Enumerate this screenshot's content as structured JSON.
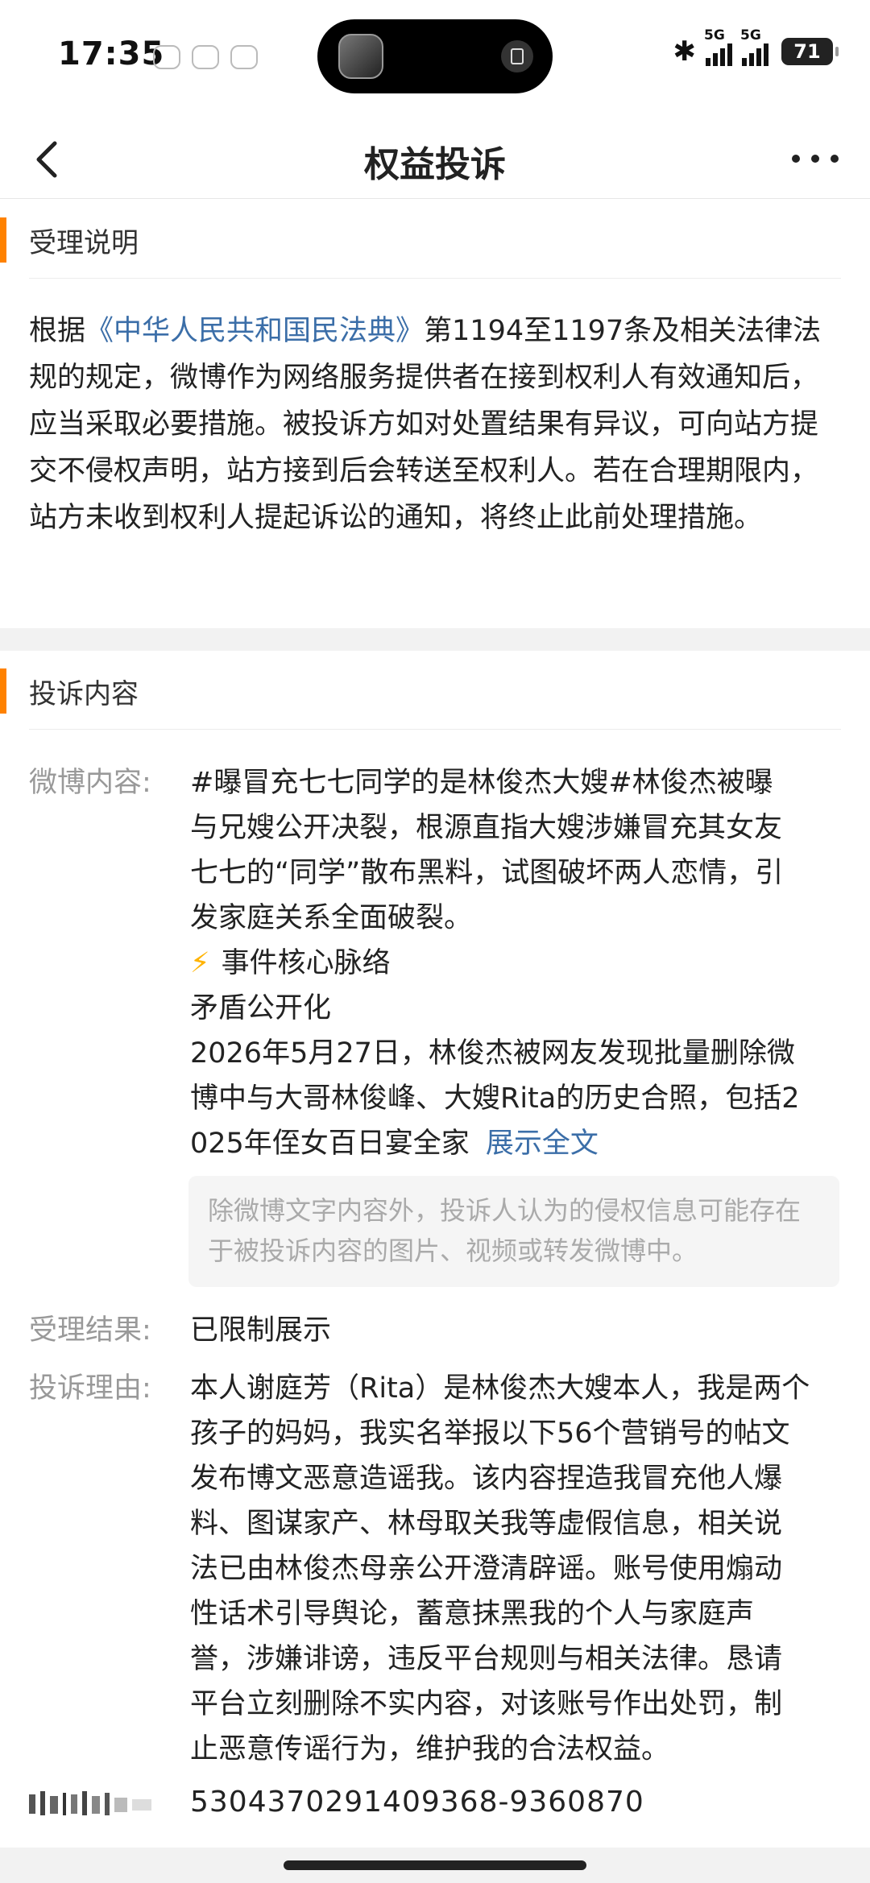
{
  "status_bar": {
    "time": "17:35",
    "network_label_1": "5G",
    "network_label_2": "5G",
    "battery": "71",
    "bluetooth_symbol": "✱"
  },
  "nav": {
    "title": "权益投诉"
  },
  "notice_section": {
    "title": "受理说明",
    "text_before_link": "根据",
    "law_link": "《中华人民共和国民法典》",
    "text_after_link": "第1194至1197条及相关法律法规的规定，微博作为网络服务提供者在接到权利人有效通知后，应当采取必要措施。被投诉方如对处置结果有异议，可向站方提交不侵权声明，站方接到后会转送至权利人。若在合理期限内，站方未收到权利人提起诉讼的通知，将终止此前处理措施。"
  },
  "complaint_section": {
    "title": "投诉内容",
    "weibo_content_label": "微博内容:",
    "weibo_content_lines": [
      "#曝冒充七七同学的是林俊杰大嫂#林俊杰被曝",
      "与兄嫂公开决裂，根源直指大嫂涉嫌冒充其女友",
      "七七的“同学”散布黑料，试图破坏两人恋情，引",
      "发家庭关系全面破裂。",
      "事件核心脉络",
      "矛盾公开化",
      "2026年5月27日，林俊杰被网友发现批量删除微",
      "博中与大哥林俊峰、大嫂Rita的历史合照，包括2",
      "025年侄女百日宴全家"
    ],
    "bolt_symbol": "⚡",
    "expand_link": "展示全文",
    "hint": "除微博文字内容外，投诉人认为的侵权信息可能存在于被投诉内容的图片、视频或转发微博中。",
    "result_label": "受理结果:",
    "result_value": "已限制展示",
    "reason_label": "投诉理由:",
    "reason_lines": [
      "本人谢庭芳（Rita）是林俊杰大嫂本人，我是两个",
      "孩子的妈妈，我实名举报以下56个营销号的帖文",
      "发布博文恶意造谣我。该内容捏造我冒充他人爆",
      "料、图谋家产、林母取关我等虚假信息，相关说",
      "法已由林俊杰母亲公开澄清辟谣。账号使用煽动",
      "性话术引导舆论，蓄意抹黑我的个人与家庭声",
      "誉，涉嫌诽谤，违反平台规则与相关法律。恳请",
      "平台立刻删除不实内容，对该账号作出处罚，制",
      "止恶意传谣行为，维护我的合法权益。"
    ],
    "complaint_id": "5304370291409368-9360870"
  },
  "colors": {
    "accent": "#ff8200",
    "link": "#3b6ea8",
    "label_gray": "#999999"
  }
}
